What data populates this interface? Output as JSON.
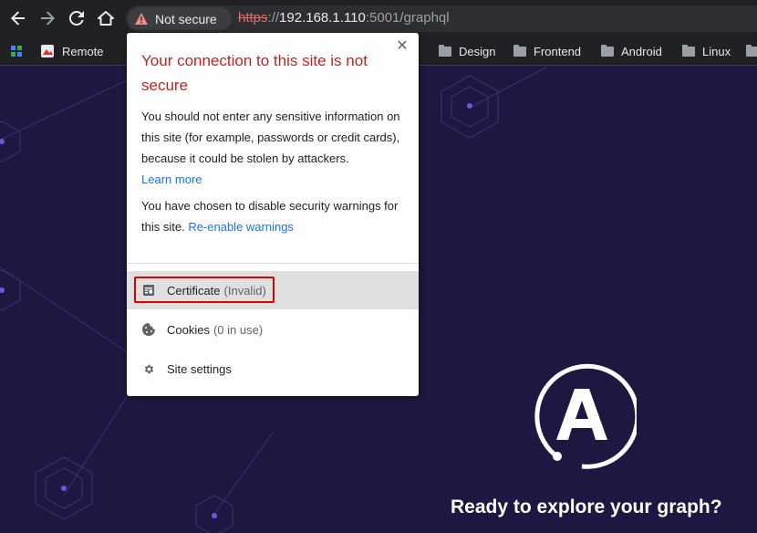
{
  "toolbar": {
    "icons": [
      "back-arrow-icon",
      "forward-arrow-icon",
      "reload-icon",
      "home-icon"
    ],
    "security_chip": {
      "label": "Not secure",
      "icon": "warning-icon",
      "icon_color": "#f28b82"
    },
    "url": {
      "scheme": "https",
      "separator": "://",
      "host": "192.168.1.110",
      "rest": ":5001/graphql"
    }
  },
  "bookmarks": {
    "items": [
      {
        "label": "",
        "icon": "apps-icon"
      },
      {
        "label": "Remote",
        "icon": "bookmark-favicon-icon"
      },
      {
        "label": "Design",
        "icon": "folder-icon"
      },
      {
        "label": "Frontend",
        "icon": "folder-icon"
      },
      {
        "label": "Android",
        "icon": "folder-icon"
      },
      {
        "label": "Linux",
        "icon": "folder-icon"
      }
    ]
  },
  "popup": {
    "title": "Your connection to this site is not secure",
    "body": "You should not enter any sensitive information on this site (for example, passwords or credit cards), because it could be stolen by attackers.",
    "learn_more": "Learn more",
    "warning_text": "You have chosen to disable security warnings for this site.",
    "reenable_link": "Re-enable warnings",
    "rows": [
      {
        "label": "Certificate",
        "sub": "(Invalid)",
        "icon": "certificate-icon",
        "highlighted": true
      },
      {
        "label": "Cookies",
        "sub": "(0 in use)",
        "icon": "cookie-icon"
      },
      {
        "label": "Site settings",
        "sub": "",
        "icon": "gear-icon"
      }
    ]
  },
  "page": {
    "heading": "Ready to explore your graph?",
    "logo": "apollo-logo",
    "colors": {
      "background": "#1d1841",
      "accent": "#7156d9",
      "highlight_border": "#e00000",
      "title_red": "#c5221f",
      "link": "#1a73e8"
    }
  }
}
